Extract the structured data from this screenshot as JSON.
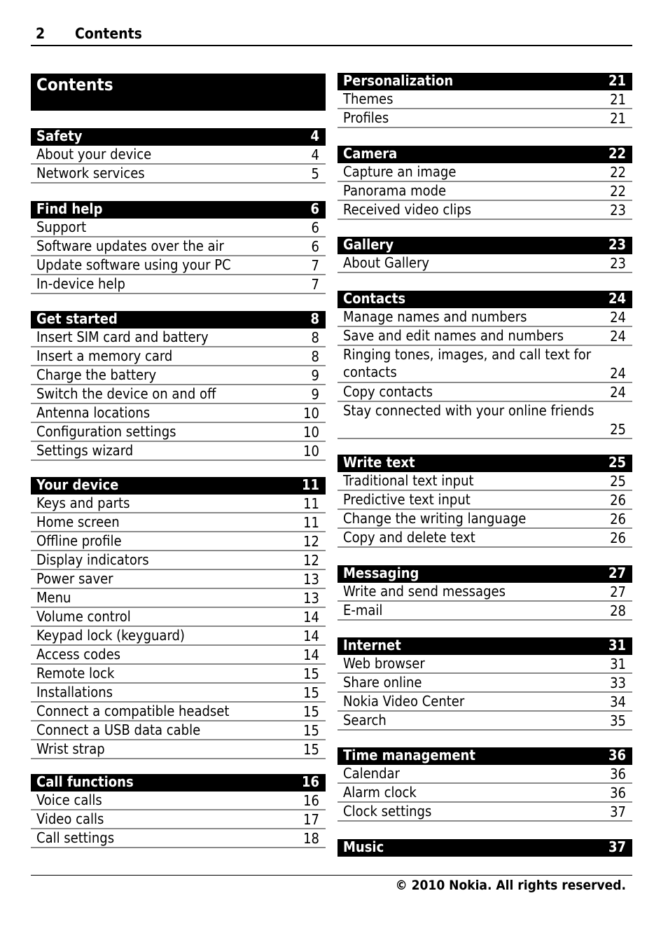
{
  "header": {
    "page_number": "2",
    "title": "Contents"
  },
  "contents_title": "Contents",
  "left_sections": [
    {
      "title": "Safety",
      "page": "4",
      "entries": [
        {
          "title": "About your device",
          "page": "4"
        },
        {
          "title": "Network services",
          "page": "5"
        }
      ]
    },
    {
      "title": "Find help",
      "page": "6",
      "entries": [
        {
          "title": "Support",
          "page": "6"
        },
        {
          "title": "Software updates over the air",
          "page": "6"
        },
        {
          "title": "Update software using your PC",
          "page": "7"
        },
        {
          "title": "In-device help",
          "page": "7"
        }
      ]
    },
    {
      "title": "Get started",
      "page": "8",
      "entries": [
        {
          "title": "Insert SIM card and battery",
          "page": "8"
        },
        {
          "title": "Insert a memory card",
          "page": "8"
        },
        {
          "title": "Charge the battery",
          "page": "9"
        },
        {
          "title": "Switch the device on and off",
          "page": "9"
        },
        {
          "title": "Antenna locations",
          "page": "10"
        },
        {
          "title": "Configuration settings",
          "page": "10"
        },
        {
          "title": "Settings wizard",
          "page": "10"
        }
      ]
    },
    {
      "title": "Your device",
      "page": "11",
      "entries": [
        {
          "title": "Keys and parts",
          "page": "11"
        },
        {
          "title": "Home screen",
          "page": "11"
        },
        {
          "title": "Offline profile",
          "page": "12"
        },
        {
          "title": "Display indicators",
          "page": "12"
        },
        {
          "title": "Power saver",
          "page": "13"
        },
        {
          "title": "Menu",
          "page": "13"
        },
        {
          "title": "Volume control",
          "page": "14"
        },
        {
          "title": "Keypad lock (keyguard)",
          "page": "14"
        },
        {
          "title": "Access codes",
          "page": "14"
        },
        {
          "title": "Remote lock",
          "page": "15"
        },
        {
          "title": "Installations",
          "page": "15"
        },
        {
          "title": "Connect a compatible headset",
          "page": "15"
        },
        {
          "title": "Connect a USB data cable",
          "page": "15"
        },
        {
          "title": "Wrist strap",
          "page": "15"
        }
      ]
    },
    {
      "title": "Call functions",
      "page": "16",
      "entries": [
        {
          "title": "Voice calls",
          "page": "16"
        },
        {
          "title": "Video calls",
          "page": "17"
        },
        {
          "title": "Call settings",
          "page": "18"
        }
      ]
    }
  ],
  "right_sections": [
    {
      "title": "Personalization",
      "page": "21",
      "entries": [
        {
          "title": "Themes",
          "page": "21"
        },
        {
          "title": "Profiles",
          "page": "21"
        }
      ]
    },
    {
      "title": "Camera",
      "page": "22",
      "entries": [
        {
          "title": "Capture an image",
          "page": "22"
        },
        {
          "title": "Panorama mode",
          "page": "22"
        },
        {
          "title": "Received video clips",
          "page": "23"
        }
      ]
    },
    {
      "title": "Gallery",
      "page": "23",
      "entries": [
        {
          "title": "About Gallery",
          "page": "23"
        }
      ]
    },
    {
      "title": "Contacts",
      "page": "24",
      "entries": [
        {
          "title": "Manage names and numbers",
          "page": "24"
        },
        {
          "title": "Save and edit names and numbers",
          "page": "24"
        },
        {
          "title": "Ringing tones, images, and call text for contacts",
          "page": "24"
        },
        {
          "title": "Copy contacts",
          "page": "24"
        },
        {
          "title": "Stay connected with your online friends",
          "page": "25"
        }
      ]
    },
    {
      "title": "Write text",
      "page": "25",
      "entries": [
        {
          "title": "Traditional text input",
          "page": "25"
        },
        {
          "title": "Predictive text input",
          "page": "26"
        },
        {
          "title": "Change the writing language",
          "page": "26"
        },
        {
          "title": "Copy and delete text",
          "page": "26"
        }
      ]
    },
    {
      "title": "Messaging",
      "page": "27",
      "entries": [
        {
          "title": "Write and send messages",
          "page": "27"
        },
        {
          "title": "E-mail",
          "page": "28"
        }
      ]
    },
    {
      "title": "Internet",
      "page": "31",
      "entries": [
        {
          "title": "Web browser",
          "page": "31"
        },
        {
          "title": "Share online",
          "page": "33"
        },
        {
          "title": "Nokia Video Center",
          "page": "34"
        },
        {
          "title": "Search",
          "page": "35"
        }
      ]
    },
    {
      "title": "Time management",
      "page": "36",
      "entries": [
        {
          "title": "Calendar",
          "page": "36"
        },
        {
          "title": "Alarm clock",
          "page": "36"
        },
        {
          "title": "Clock settings",
          "page": "37"
        }
      ]
    },
    {
      "title": "Music",
      "page": "37",
      "entries": []
    }
  ],
  "footer": {
    "copyright": "© 2010 Nokia. All rights reserved."
  }
}
